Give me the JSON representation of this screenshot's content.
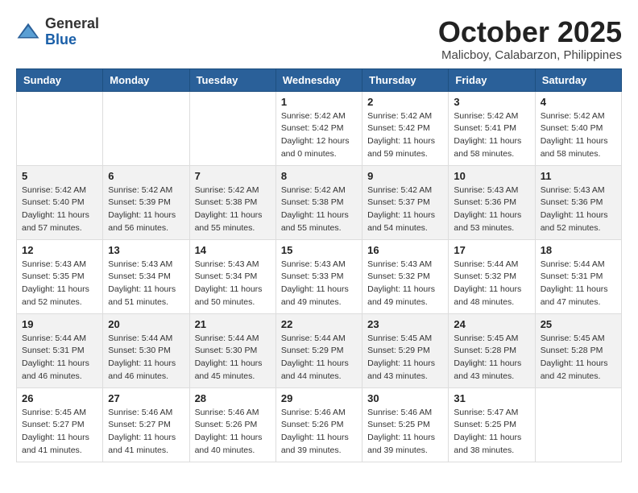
{
  "header": {
    "logo": {
      "general": "General",
      "blue": "Blue"
    },
    "title": "October 2025",
    "location": "Malicboy, Calabarzon, Philippines"
  },
  "days": [
    "Sunday",
    "Monday",
    "Tuesday",
    "Wednesday",
    "Thursday",
    "Friday",
    "Saturday"
  ],
  "weeks": [
    [
      {
        "date": "",
        "info": ""
      },
      {
        "date": "",
        "info": ""
      },
      {
        "date": "",
        "info": ""
      },
      {
        "date": "1",
        "info": "Sunrise: 5:42 AM\nSunset: 5:42 PM\nDaylight: 12 hours\nand 0 minutes."
      },
      {
        "date": "2",
        "info": "Sunrise: 5:42 AM\nSunset: 5:42 PM\nDaylight: 11 hours\nand 59 minutes."
      },
      {
        "date": "3",
        "info": "Sunrise: 5:42 AM\nSunset: 5:41 PM\nDaylight: 11 hours\nand 58 minutes."
      },
      {
        "date": "4",
        "info": "Sunrise: 5:42 AM\nSunset: 5:40 PM\nDaylight: 11 hours\nand 58 minutes."
      }
    ],
    [
      {
        "date": "5",
        "info": "Sunrise: 5:42 AM\nSunset: 5:40 PM\nDaylight: 11 hours\nand 57 minutes."
      },
      {
        "date": "6",
        "info": "Sunrise: 5:42 AM\nSunset: 5:39 PM\nDaylight: 11 hours\nand 56 minutes."
      },
      {
        "date": "7",
        "info": "Sunrise: 5:42 AM\nSunset: 5:38 PM\nDaylight: 11 hours\nand 55 minutes."
      },
      {
        "date": "8",
        "info": "Sunrise: 5:42 AM\nSunset: 5:38 PM\nDaylight: 11 hours\nand 55 minutes."
      },
      {
        "date": "9",
        "info": "Sunrise: 5:42 AM\nSunset: 5:37 PM\nDaylight: 11 hours\nand 54 minutes."
      },
      {
        "date": "10",
        "info": "Sunrise: 5:43 AM\nSunset: 5:36 PM\nDaylight: 11 hours\nand 53 minutes."
      },
      {
        "date": "11",
        "info": "Sunrise: 5:43 AM\nSunset: 5:36 PM\nDaylight: 11 hours\nand 52 minutes."
      }
    ],
    [
      {
        "date": "12",
        "info": "Sunrise: 5:43 AM\nSunset: 5:35 PM\nDaylight: 11 hours\nand 52 minutes."
      },
      {
        "date": "13",
        "info": "Sunrise: 5:43 AM\nSunset: 5:34 PM\nDaylight: 11 hours\nand 51 minutes."
      },
      {
        "date": "14",
        "info": "Sunrise: 5:43 AM\nSunset: 5:34 PM\nDaylight: 11 hours\nand 50 minutes."
      },
      {
        "date": "15",
        "info": "Sunrise: 5:43 AM\nSunset: 5:33 PM\nDaylight: 11 hours\nand 49 minutes."
      },
      {
        "date": "16",
        "info": "Sunrise: 5:43 AM\nSunset: 5:32 PM\nDaylight: 11 hours\nand 49 minutes."
      },
      {
        "date": "17",
        "info": "Sunrise: 5:44 AM\nSunset: 5:32 PM\nDaylight: 11 hours\nand 48 minutes."
      },
      {
        "date": "18",
        "info": "Sunrise: 5:44 AM\nSunset: 5:31 PM\nDaylight: 11 hours\nand 47 minutes."
      }
    ],
    [
      {
        "date": "19",
        "info": "Sunrise: 5:44 AM\nSunset: 5:31 PM\nDaylight: 11 hours\nand 46 minutes."
      },
      {
        "date": "20",
        "info": "Sunrise: 5:44 AM\nSunset: 5:30 PM\nDaylight: 11 hours\nand 46 minutes."
      },
      {
        "date": "21",
        "info": "Sunrise: 5:44 AM\nSunset: 5:30 PM\nDaylight: 11 hours\nand 45 minutes."
      },
      {
        "date": "22",
        "info": "Sunrise: 5:44 AM\nSunset: 5:29 PM\nDaylight: 11 hours\nand 44 minutes."
      },
      {
        "date": "23",
        "info": "Sunrise: 5:45 AM\nSunset: 5:29 PM\nDaylight: 11 hours\nand 43 minutes."
      },
      {
        "date": "24",
        "info": "Sunrise: 5:45 AM\nSunset: 5:28 PM\nDaylight: 11 hours\nand 43 minutes."
      },
      {
        "date": "25",
        "info": "Sunrise: 5:45 AM\nSunset: 5:28 PM\nDaylight: 11 hours\nand 42 minutes."
      }
    ],
    [
      {
        "date": "26",
        "info": "Sunrise: 5:45 AM\nSunset: 5:27 PM\nDaylight: 11 hours\nand 41 minutes."
      },
      {
        "date": "27",
        "info": "Sunrise: 5:46 AM\nSunset: 5:27 PM\nDaylight: 11 hours\nand 41 minutes."
      },
      {
        "date": "28",
        "info": "Sunrise: 5:46 AM\nSunset: 5:26 PM\nDaylight: 11 hours\nand 40 minutes."
      },
      {
        "date": "29",
        "info": "Sunrise: 5:46 AM\nSunset: 5:26 PM\nDaylight: 11 hours\nand 39 minutes."
      },
      {
        "date": "30",
        "info": "Sunrise: 5:46 AM\nSunset: 5:25 PM\nDaylight: 11 hours\nand 39 minutes."
      },
      {
        "date": "31",
        "info": "Sunrise: 5:47 AM\nSunset: 5:25 PM\nDaylight: 11 hours\nand 38 minutes."
      },
      {
        "date": "",
        "info": ""
      }
    ]
  ]
}
